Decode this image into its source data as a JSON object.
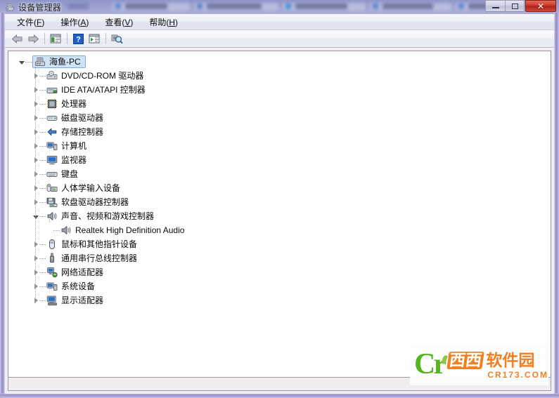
{
  "window": {
    "title": "设备管理器",
    "title_icon": "device-manager-icon",
    "buttons": {
      "minimize": "–",
      "maximize": "□",
      "close": "✕"
    }
  },
  "menubar": {
    "items": [
      {
        "pre": "文件(",
        "key": "F",
        "post": ")",
        "name": "menu-file"
      },
      {
        "pre": "操作(",
        "key": "A",
        "post": ")",
        "name": "menu-action"
      },
      {
        "pre": "查看(",
        "key": "V",
        "post": ")",
        "name": "menu-view"
      },
      {
        "pre": "帮助(",
        "key": "H",
        "post": ")",
        "name": "menu-help"
      }
    ]
  },
  "toolbar": {
    "items": [
      {
        "name": "back-button",
        "icon": "back-arrow-icon"
      },
      {
        "name": "forward-button",
        "icon": "forward-arrow-icon"
      },
      {
        "name": "show-hide-console-tree-button",
        "icon": "console-tree-icon"
      },
      {
        "name": "help-button",
        "icon": "help-question-icon"
      },
      {
        "name": "properties-button",
        "icon": "properties-icon"
      },
      {
        "name": "scan-hardware-changes-button",
        "icon": "scan-hardware-icon"
      }
    ]
  },
  "tree": {
    "root": {
      "label": "海鱼-PC",
      "icon": "computer-node-icon",
      "expanded": true,
      "selected": true
    },
    "items": [
      {
        "label": "DVD/CD-ROM 驱动器",
        "icon": "dvd-drive-icon",
        "state": "collapsed",
        "depth": 1
      },
      {
        "label": "IDE ATA/ATAPI 控制器",
        "icon": "ide-controller-icon",
        "state": "collapsed",
        "depth": 1
      },
      {
        "label": "处理器",
        "icon": "processor-icon",
        "state": "collapsed",
        "depth": 1
      },
      {
        "label": "磁盘驱动器",
        "icon": "disk-drive-icon",
        "state": "collapsed",
        "depth": 1
      },
      {
        "label": "存储控制器",
        "icon": "storage-controller-icon",
        "state": "collapsed",
        "depth": 1
      },
      {
        "label": "计算机",
        "icon": "computer-icon",
        "state": "collapsed",
        "depth": 1
      },
      {
        "label": "监视器",
        "icon": "monitor-icon",
        "state": "collapsed",
        "depth": 1
      },
      {
        "label": "键盘",
        "icon": "keyboard-icon",
        "state": "collapsed",
        "depth": 1
      },
      {
        "label": "人体学输入设备",
        "icon": "hid-device-icon",
        "state": "collapsed",
        "depth": 1
      },
      {
        "label": "软盘驱动器控制器",
        "icon": "floppy-controller-icon",
        "state": "collapsed",
        "depth": 1
      },
      {
        "label": "声音、视频和游戏控制器",
        "icon": "sound-video-game-icon",
        "state": "expanded",
        "depth": 1
      },
      {
        "label": "Realtek High Definition Audio",
        "icon": "audio-device-icon",
        "state": "leaf",
        "depth": 2
      },
      {
        "label": "鼠标和其他指针设备",
        "icon": "mouse-icon",
        "state": "collapsed",
        "depth": 1
      },
      {
        "label": "通用串行总线控制器",
        "icon": "usb-controller-icon",
        "state": "collapsed",
        "depth": 1
      },
      {
        "label": "网络适配器",
        "icon": "network-adapter-icon",
        "state": "collapsed",
        "depth": 1
      },
      {
        "label": "系统设备",
        "icon": "system-device-icon",
        "state": "collapsed",
        "depth": 1
      },
      {
        "label": "显示适配器",
        "icon": "display-adapter-icon",
        "state": "collapsed",
        "depth": 1
      }
    ]
  },
  "statusbar": {
    "text": ""
  },
  "watermark": {
    "logo_letters": "Cr",
    "brand_part1": "西西",
    "brand_part2": "软件园",
    "url": "CR173.COM"
  },
  "colors": {
    "frame": "#9a92cb",
    "close_button": "#c9372a",
    "selection": "#cfe3f7",
    "selection_border": "#7fa9d4",
    "tree_bg": "#ffffff",
    "watermark_green": "#52b319",
    "watermark_orange": "#f07d1b"
  }
}
